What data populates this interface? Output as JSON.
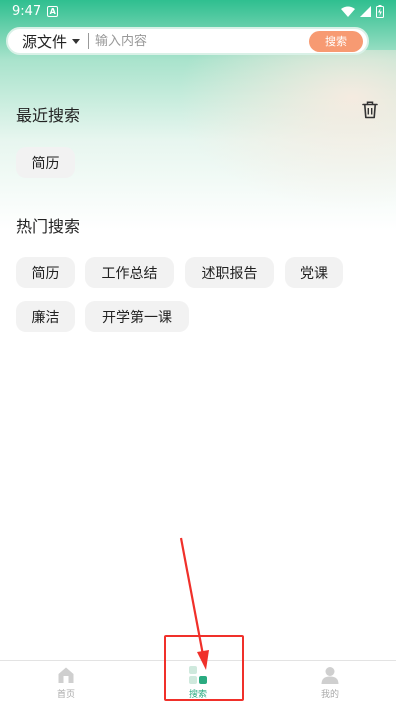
{
  "status": {
    "time": "9:47",
    "notification_glyph": "A"
  },
  "search": {
    "source_label": "源文件",
    "placeholder": "输入内容",
    "button_label": "搜索"
  },
  "recent": {
    "title": "最近搜索",
    "items": [
      "简历"
    ]
  },
  "hot": {
    "title": "热门搜索",
    "items": [
      "简历",
      "工作总结",
      "述职报告",
      "党课",
      "廉洁",
      "开学第一课"
    ]
  },
  "tabbar": {
    "items": [
      {
        "label": "首页",
        "icon": "home-icon"
      },
      {
        "label": "搜索",
        "icon": "search-grid-icon",
        "active": true
      },
      {
        "label": "我的",
        "icon": "user-icon"
      }
    ]
  },
  "colors": {
    "accent": "#2aab80",
    "search_button": "#f79a72",
    "highlight": "#f0302a"
  }
}
